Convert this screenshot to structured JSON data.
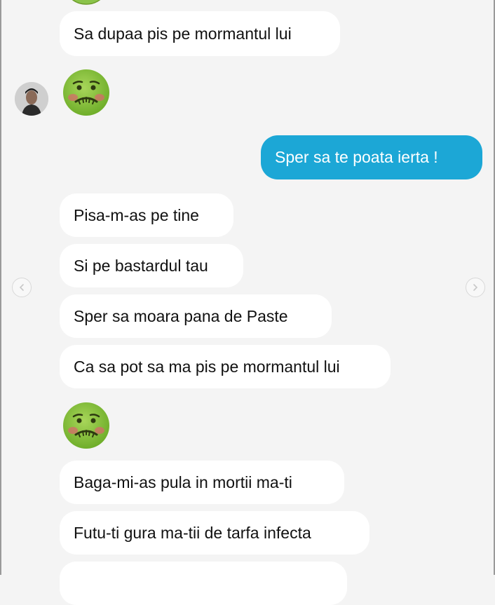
{
  "conversation": {
    "messages": [
      {
        "text": "Sa dupaa pis pe mormantul lui",
        "from": "them"
      },
      {
        "emoji": "nauseated-face",
        "from": "them"
      },
      {
        "text": "Sper sa te poata ierta !",
        "from": "me"
      },
      {
        "text": "Pisa-m-as pe tine",
        "from": "them"
      },
      {
        "text": "Si pe bastardul tau",
        "from": "them"
      },
      {
        "text": "Sper sa moara pana de Paste",
        "from": "them"
      },
      {
        "text": "Ca sa pot sa ma pis pe mormantul lui",
        "from": "them"
      },
      {
        "emoji": "nauseated-face",
        "from": "them"
      },
      {
        "text": "Baga-mi-as pula in mortii ma-ti",
        "from": "them"
      },
      {
        "text": "Futu-ti gura ma-tii de tarfa infecta",
        "from": "them"
      }
    ]
  },
  "navigation": {
    "prev_icon": "chevron-left-icon",
    "next_icon": "chevron-right-icon"
  },
  "colors": {
    "background": "#f4f4f4",
    "incoming_bubble": "#ffffff",
    "outgoing_bubble": "#1ca7d6"
  }
}
